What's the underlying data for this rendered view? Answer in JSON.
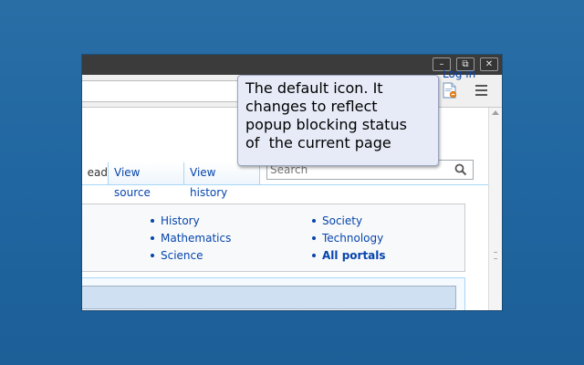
{
  "window": {
    "buttons": {
      "minimize": "–",
      "restore": "⧉",
      "close": "✕"
    }
  },
  "toolbar": {
    "extension_icon": "popup-blocker-icon",
    "menu_icon": "hamburger-menu-icon"
  },
  "page": {
    "login_label": "Log in",
    "tabs": [
      {
        "label": "ead"
      },
      {
        "label": "View source"
      },
      {
        "label": "View history"
      }
    ],
    "search_placeholder": "Search",
    "portals_col1": [
      "History",
      "Mathematics",
      "Science"
    ],
    "portals_col2": [
      "Society",
      "Technology",
      "All portals"
    ]
  },
  "tooltip": {
    "lines": [
      "The default icon. It",
      "changes to reflect",
      "popup blocking status",
      "of  the current page"
    ]
  },
  "colors": {
    "desktop": "#2066a0",
    "link": "#0645ad",
    "titlebar": "#3b3b3b",
    "tooltip_bg": "#e6ebf7"
  }
}
